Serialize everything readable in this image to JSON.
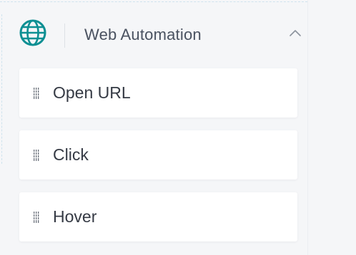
{
  "panel": {
    "title": "Web Automation",
    "header_icon": "globe-icon",
    "toggle_icon": "chevron-up-icon",
    "accent_color": "#0d8f93"
  },
  "items": [
    {
      "label": "Open URL",
      "icon": "drag-handle-icon"
    },
    {
      "label": "Click",
      "icon": "drag-handle-icon"
    },
    {
      "label": "Hover",
      "icon": "drag-handle-icon"
    }
  ]
}
